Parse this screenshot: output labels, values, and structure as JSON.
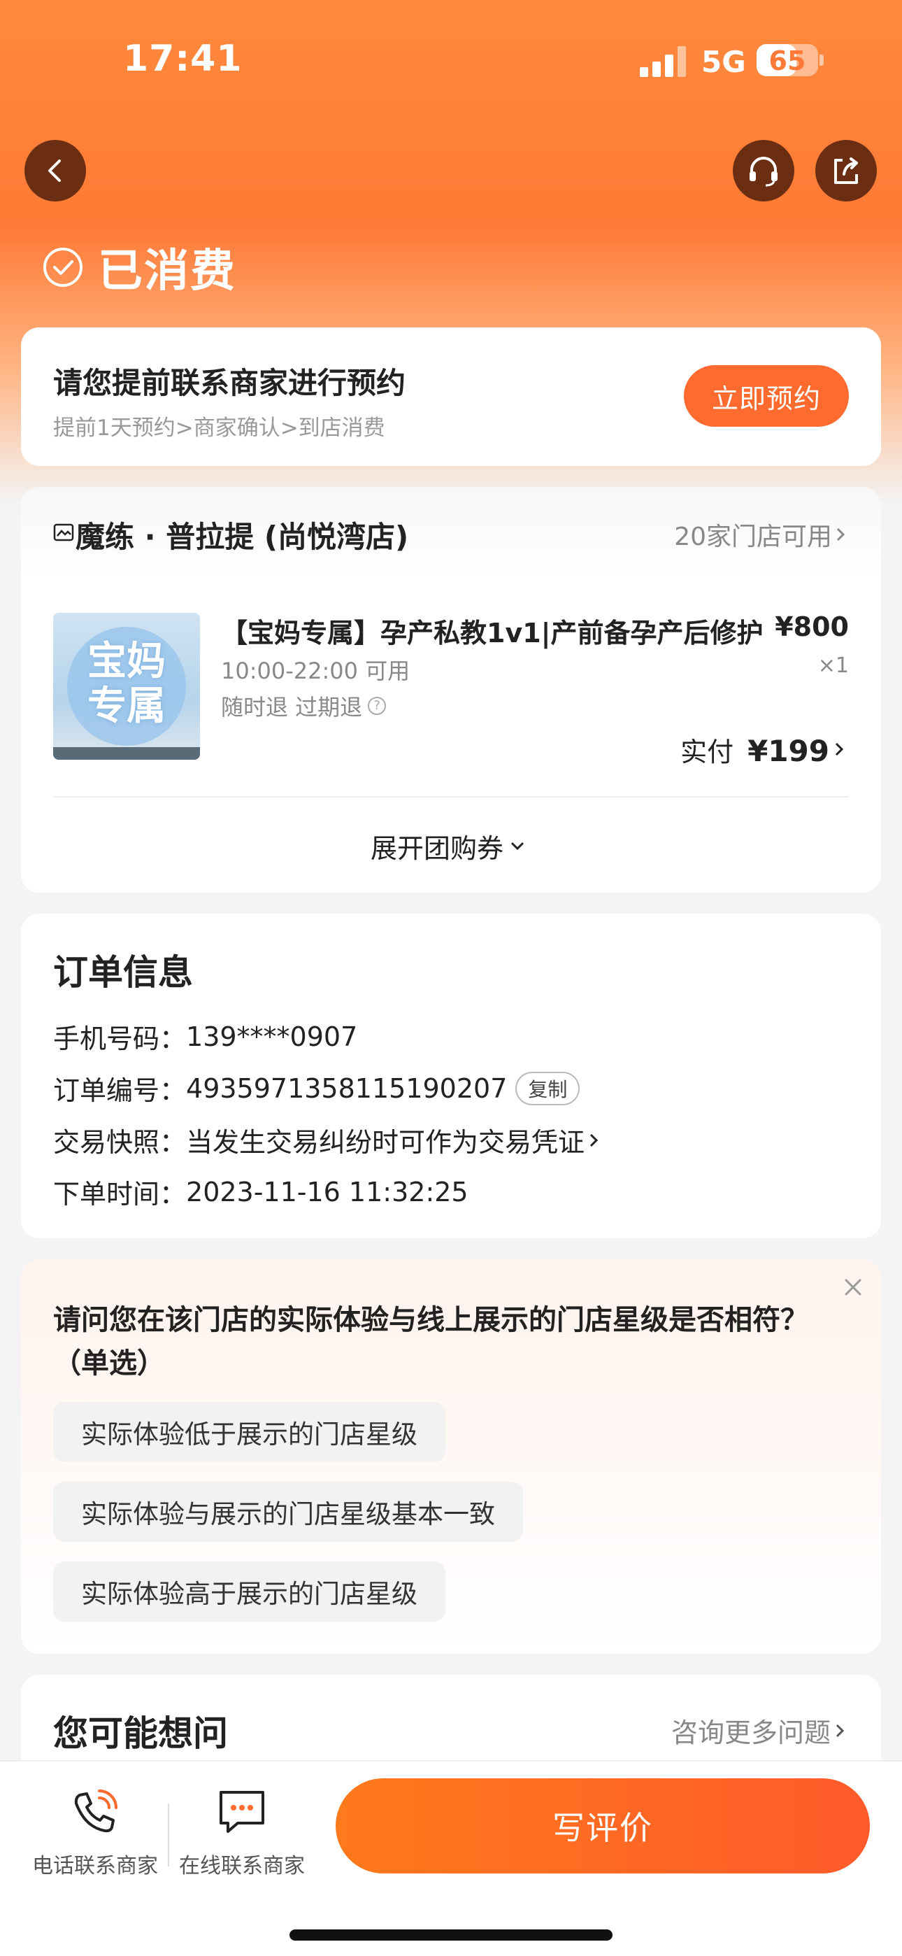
{
  "status_bar": {
    "time": "17:41",
    "network": "5G",
    "battery": "65",
    "battery_level": 0.65
  },
  "header": {
    "status_text": "已消费",
    "icons": {
      "back": "back-arrow-icon",
      "support": "headset-icon",
      "share": "share-icon",
      "status": "check-circle-icon"
    }
  },
  "booking": {
    "title": "请您提前联系商家进行预约",
    "subtitle": "提前1天预约>商家确认>到店消费",
    "button_label": "立即预约"
  },
  "store": {
    "name": "魔练 · 普拉提 (尚悦湾店)",
    "stores_available": "20家门店可用",
    "product": {
      "thumb_text": "宝妈专属",
      "title": "【宝妈专属】孕产私教1v1|产前备孕产后修护",
      "price": "¥800",
      "quantity": "×1",
      "hours": "10:00-22:00 可用",
      "refund": "随时退 过期退",
      "paid_label": "实付",
      "paid_value": "¥199"
    },
    "expand_label": "展开团购券"
  },
  "order": {
    "title": "订单信息",
    "phone_label": "手机号码：",
    "phone": "139****0907",
    "order_no_label": "订单编号：",
    "order_no": "4935971358115190207",
    "copy_label": "复制",
    "snapshot_label": "交易快照：",
    "snapshot_text": "当发生交易纠纷时可作为交易凭证",
    "time_label": "下单时间：",
    "time": "2023-11-16 11:32:25"
  },
  "survey": {
    "question": "请问您在该门店的实际体验与线上展示的门店星级是否相符？（单选）",
    "options": [
      "实际体验低于展示的门店星级",
      "实际体验与展示的门店星级基本一致",
      "实际体验高于展示的门店星级"
    ]
  },
  "faq": {
    "title": "您可能想问",
    "more_label": "咨询更多问题"
  },
  "bottom_bar": {
    "phone_label": "电话联系商家",
    "chat_label": "在线联系商家",
    "review_label": "写评价"
  },
  "colors": {
    "accent": "#ff6a2f",
    "header": "#ff7a36",
    "icon_bg": "#6b2e12"
  }
}
